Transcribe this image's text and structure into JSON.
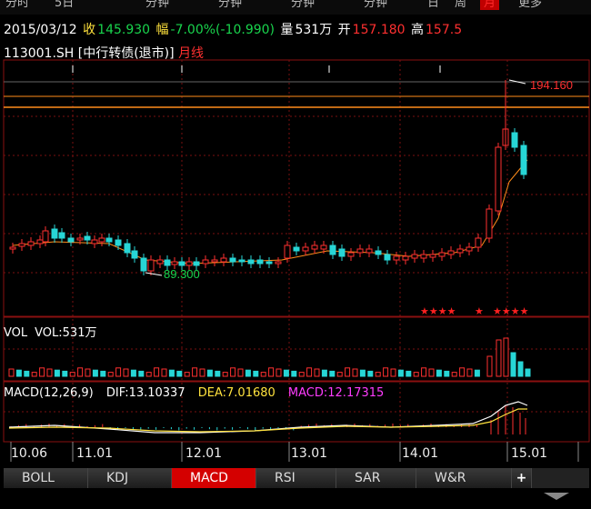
{
  "top_strip": {
    "items": [
      "分时",
      "5日",
      "分钟",
      "分钟",
      "分钟",
      "分钟",
      "日",
      "周"
    ],
    "active": "月",
    "extra": "更多"
  },
  "quote": {
    "date": "2015/03/12",
    "close_label": "收",
    "close": "145.930",
    "change_label": "幅",
    "change": "-7.00%(-10.990)",
    "volume_label": "量",
    "volume": "531万",
    "open_label": "开",
    "open": "157.180",
    "high_label": "高",
    "high": "157.5"
  },
  "instrument": {
    "code": "113001.SH [中行转债(退市)]",
    "period": "月线"
  },
  "annotations": {
    "high_price": "194.160",
    "low_price": "89.300",
    "stars_left": "★★★★",
    "star_mid": "★",
    "stars_right": "★★★★"
  },
  "volume_panel": {
    "title": "VOL",
    "value_label": "VOL:531万"
  },
  "macd_panel": {
    "title": "MACD(12,26,9)",
    "dif": "DIF:13.10337",
    "dea": "DEA:7.01680",
    "macd": "MACD:12.17315"
  },
  "x_axis": [
    "10.06",
    "11.01",
    "12.01",
    "13.01",
    "14.01",
    "15.01"
  ],
  "tabs": [
    "BOLL",
    "KDJ",
    "MACD",
    "RSI",
    "SAR",
    "W&R"
  ],
  "active_tab": "MACD",
  "colors": {
    "up": "#ff3030",
    "down": "#27d6d6",
    "dif": "#ffffff",
    "dea": "#ffe23d",
    "ma": "#ff8c1a",
    "grid": "#7a1010"
  }
}
